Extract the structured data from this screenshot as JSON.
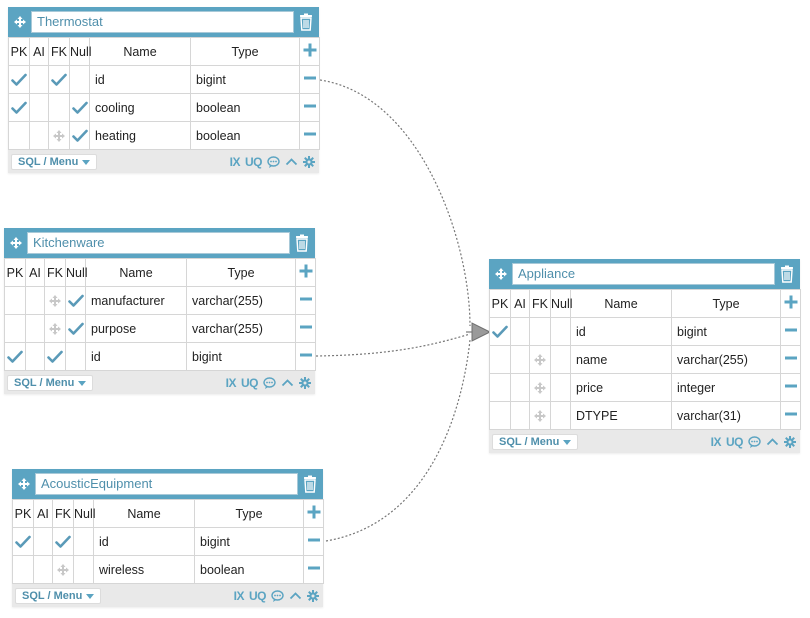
{
  "headers": {
    "pk": "PK",
    "ai": "AI",
    "fk": "FK",
    "null": "Null",
    "name": "Name",
    "type": "Type"
  },
  "footer": {
    "sql_menu": "SQL / Menu",
    "ix": "IX",
    "uq": "UQ"
  },
  "colors": {
    "accent": "#5ba4c2",
    "check": "#5a9ab8",
    "muted": "#c8c8c8",
    "footer_bg": "#e9e9e9",
    "link_line": "#777777"
  },
  "tables": {
    "thermostat": {
      "name": "Thermostat",
      "columns": [
        {
          "pk": true,
          "ai": false,
          "fk": true,
          "null": false,
          "name": "id",
          "type": "bigint"
        },
        {
          "pk": true,
          "ai": false,
          "fk": false,
          "null": true,
          "name": "cooling",
          "type": "boolean"
        },
        {
          "pk": false,
          "ai": false,
          "fk": false,
          "null": true,
          "name": "heating",
          "type": "boolean"
        }
      ]
    },
    "kitchenware": {
      "name": "Kitchenware",
      "columns": [
        {
          "pk": false,
          "ai": false,
          "fk": false,
          "null": true,
          "name": "manufacturer",
          "type": "varchar(255)"
        },
        {
          "pk": false,
          "ai": false,
          "fk": false,
          "null": true,
          "name": "purpose",
          "type": "varchar(255)"
        },
        {
          "pk": true,
          "ai": false,
          "fk": true,
          "null": false,
          "name": "id",
          "type": "bigint"
        }
      ]
    },
    "acoustic": {
      "name": "AcousticEquipment",
      "columns": [
        {
          "pk": true,
          "ai": false,
          "fk": true,
          "null": false,
          "name": "id",
          "type": "bigint"
        },
        {
          "pk": false,
          "ai": false,
          "fk": false,
          "null": false,
          "name": "wireless",
          "type": "boolean"
        }
      ]
    },
    "appliance": {
      "name": "Appliance",
      "columns": [
        {
          "pk": true,
          "ai": false,
          "fk": false,
          "null": false,
          "name": "id",
          "type": "bigint"
        },
        {
          "pk": false,
          "ai": false,
          "fk": false,
          "null": false,
          "name": "name",
          "type": "varchar(255)"
        },
        {
          "pk": false,
          "ai": false,
          "fk": false,
          "null": false,
          "name": "price",
          "type": "integer"
        },
        {
          "pk": false,
          "ai": false,
          "fk": false,
          "null": false,
          "name": "DTYPE",
          "type": "varchar(31)"
        }
      ]
    }
  },
  "relations": [
    {
      "from": "thermostat.id",
      "to": "appliance.id"
    },
    {
      "from": "kitchenware.id",
      "to": "appliance.id"
    },
    {
      "from": "acoustic.id",
      "to": "appliance.id"
    }
  ]
}
